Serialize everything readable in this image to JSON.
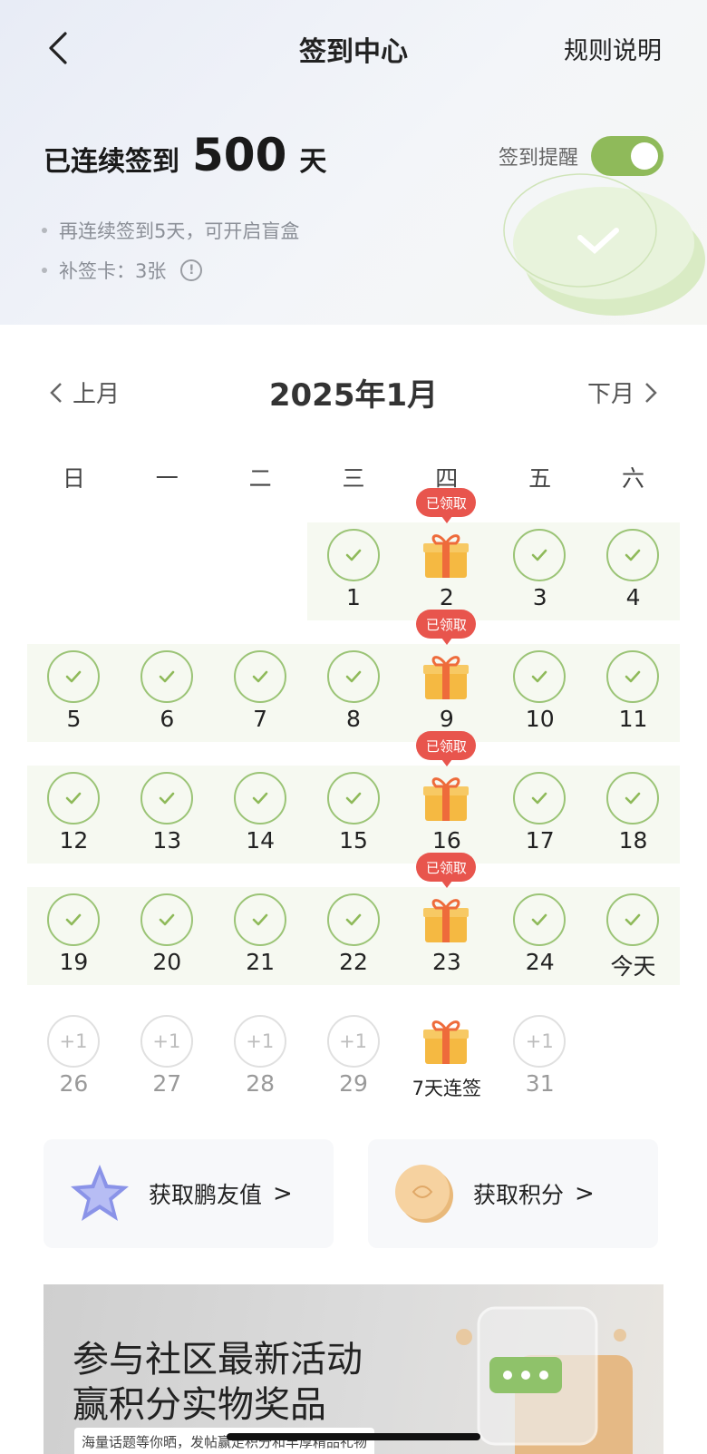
{
  "header": {
    "title": "签到中心",
    "rules_label": "规则说明"
  },
  "streak": {
    "prefix": "已连续签到",
    "count": "500",
    "suffix": "天"
  },
  "bullets": [
    "再连续签到5天，可开启盲盒",
    "补签卡：3张"
  ],
  "reminder": {
    "label": "签到提醒",
    "enabled": true
  },
  "calendar": {
    "prev_label": "上月",
    "next_label": "下月",
    "month_title": "2025年1月",
    "weekdays": [
      "日",
      "一",
      "二",
      "三",
      "四",
      "五",
      "六"
    ],
    "claimed_badge": "已领取",
    "weeks": [
      [
        {
          "day": ""
        },
        {
          "day": ""
        },
        {
          "day": ""
        },
        {
          "day": "1",
          "state": "checked"
        },
        {
          "day": "2",
          "state": "gift-claimed"
        },
        {
          "day": "3",
          "state": "checked"
        },
        {
          "day": "4",
          "state": "checked"
        }
      ],
      [
        {
          "day": "5",
          "state": "checked"
        },
        {
          "day": "6",
          "state": "checked"
        },
        {
          "day": "7",
          "state": "checked"
        },
        {
          "day": "8",
          "state": "checked"
        },
        {
          "day": "9",
          "state": "gift-claimed"
        },
        {
          "day": "10",
          "state": "checked"
        },
        {
          "day": "11",
          "state": "checked"
        }
      ],
      [
        {
          "day": "12",
          "state": "checked"
        },
        {
          "day": "13",
          "state": "checked"
        },
        {
          "day": "14",
          "state": "checked"
        },
        {
          "day": "15",
          "state": "checked"
        },
        {
          "day": "16",
          "state": "gift-claimed"
        },
        {
          "day": "17",
          "state": "checked"
        },
        {
          "day": "18",
          "state": "checked"
        }
      ],
      [
        {
          "day": "19",
          "state": "checked"
        },
        {
          "day": "20",
          "state": "checked"
        },
        {
          "day": "21",
          "state": "checked"
        },
        {
          "day": "22",
          "state": "checked"
        },
        {
          "day": "23",
          "state": "gift-claimed"
        },
        {
          "day": "24",
          "state": "checked"
        },
        {
          "day": "今天",
          "state": "checked"
        }
      ],
      [
        {
          "day": "26",
          "state": "future",
          "bonus": "+1"
        },
        {
          "day": "27",
          "state": "future",
          "bonus": "+1"
        },
        {
          "day": "28",
          "state": "future",
          "bonus": "+1"
        },
        {
          "day": "29",
          "state": "future",
          "bonus": "+1"
        },
        {
          "day": "7天连签",
          "state": "gift"
        },
        {
          "day": "31",
          "state": "future",
          "bonus": "+1"
        },
        {
          "day": ""
        }
      ]
    ]
  },
  "cards": [
    {
      "label": "获取鹏友值",
      "icon": "star-crystal-icon"
    },
    {
      "label": "获取积分",
      "icon": "gold-coin-icon"
    }
  ],
  "banner": {
    "line1": "参与社区最新活动",
    "line2": "赢积分实物奖品",
    "sub": "海量话题等你晒，发帖赢走积分和丰厚精品礼物"
  },
  "colors": {
    "accent_green": "#8fba5a",
    "badge_red": "#e8554d",
    "gift_gold": "#f5b942"
  }
}
